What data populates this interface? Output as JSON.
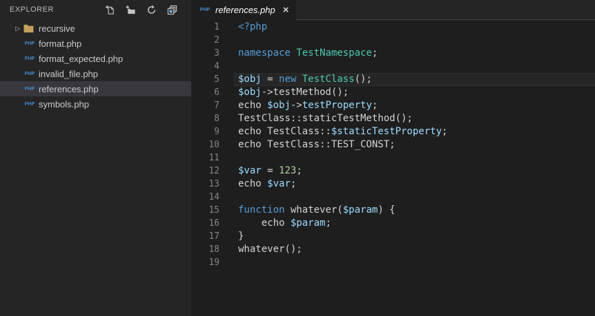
{
  "colors": {
    "editor_bg": "#1e1e1e",
    "sidebar_bg": "#252526",
    "tabbar_bg": "#252526",
    "selected_bg": "#37373d",
    "keyword": "#569cd6",
    "class_name": "#4ec9b0",
    "variable": "#9cdcfe",
    "number": "#b5cea8",
    "plain": "#d4d4d4",
    "line_number": "#858585",
    "php_icon": "#4788c7",
    "folder_icon": "#c4a25e"
  },
  "icons": {
    "php_label": "PHP",
    "chevron_collapsed": "▷"
  },
  "sidebar": {
    "title": "EXPLORER",
    "actions": [
      {
        "name": "new-file"
      },
      {
        "name": "new-folder"
      },
      {
        "name": "refresh"
      },
      {
        "name": "collapse-all"
      }
    ],
    "files": [
      {
        "label": "recursive",
        "kind": "folder",
        "expanded": false,
        "selected": false
      },
      {
        "label": "format.php",
        "kind": "php",
        "selected": false
      },
      {
        "label": "format_expected.php",
        "kind": "php",
        "selected": false
      },
      {
        "label": "invalid_file.php",
        "kind": "php",
        "selected": false
      },
      {
        "label": "references.php",
        "kind": "php",
        "selected": true
      },
      {
        "label": "symbols.php",
        "kind": "php",
        "selected": false
      }
    ]
  },
  "editor": {
    "tab": {
      "label": "references.php",
      "icon": "php",
      "preview_italic": true,
      "close_glyph": "×"
    },
    "active_line": 5,
    "code_lines": [
      {
        "num": 1,
        "tokens": [
          [
            "<?php",
            "k"
          ]
        ]
      },
      {
        "num": 2,
        "tokens": []
      },
      {
        "num": 3,
        "tokens": [
          [
            "namespace",
            "k"
          ],
          [
            " ",
            "p"
          ],
          [
            "TestNamespace",
            "c"
          ],
          [
            ";",
            "p"
          ]
        ]
      },
      {
        "num": 4,
        "tokens": []
      },
      {
        "num": 5,
        "tokens": [
          [
            "$obj",
            "v"
          ],
          [
            " = ",
            "p"
          ],
          [
            "new",
            "k"
          ],
          [
            " ",
            "p"
          ],
          [
            "TestClass",
            "c"
          ],
          [
            "();",
            "p"
          ]
        ]
      },
      {
        "num": 6,
        "tokens": [
          [
            "$obj",
            "v"
          ],
          [
            "->testMethod();",
            "p"
          ]
        ]
      },
      {
        "num": 7,
        "tokens": [
          [
            "echo ",
            "p"
          ],
          [
            "$obj",
            "v"
          ],
          [
            "->",
            "p"
          ],
          [
            "testProperty",
            "v"
          ],
          [
            ";",
            "p"
          ]
        ]
      },
      {
        "num": 8,
        "tokens": [
          [
            "TestClass::staticTestMethod();",
            "p"
          ]
        ]
      },
      {
        "num": 9,
        "tokens": [
          [
            "echo TestClass::",
            "p"
          ],
          [
            "$staticTestProperty",
            "v"
          ],
          [
            ";",
            "p"
          ]
        ]
      },
      {
        "num": 10,
        "tokens": [
          [
            "echo TestClass::TEST_CONST;",
            "p"
          ]
        ]
      },
      {
        "num": 11,
        "tokens": []
      },
      {
        "num": 12,
        "tokens": [
          [
            "$var",
            "v"
          ],
          [
            " = ",
            "p"
          ],
          [
            "123",
            "n"
          ],
          [
            ";",
            "p"
          ]
        ]
      },
      {
        "num": 13,
        "tokens": [
          [
            "echo ",
            "p"
          ],
          [
            "$var",
            "v"
          ],
          [
            ";",
            "p"
          ]
        ]
      },
      {
        "num": 14,
        "tokens": []
      },
      {
        "num": 15,
        "tokens": [
          [
            "function",
            "k"
          ],
          [
            " whatever(",
            "p"
          ],
          [
            "$param",
            "v"
          ],
          [
            ") {",
            "p"
          ]
        ]
      },
      {
        "num": 16,
        "tokens": [
          [
            "    echo ",
            "p"
          ],
          [
            "$param",
            "v"
          ],
          [
            ";",
            "p"
          ]
        ]
      },
      {
        "num": 17,
        "tokens": [
          [
            "}",
            "p"
          ]
        ]
      },
      {
        "num": 18,
        "tokens": [
          [
            "whatever();",
            "p"
          ]
        ]
      },
      {
        "num": 19,
        "tokens": []
      }
    ]
  }
}
